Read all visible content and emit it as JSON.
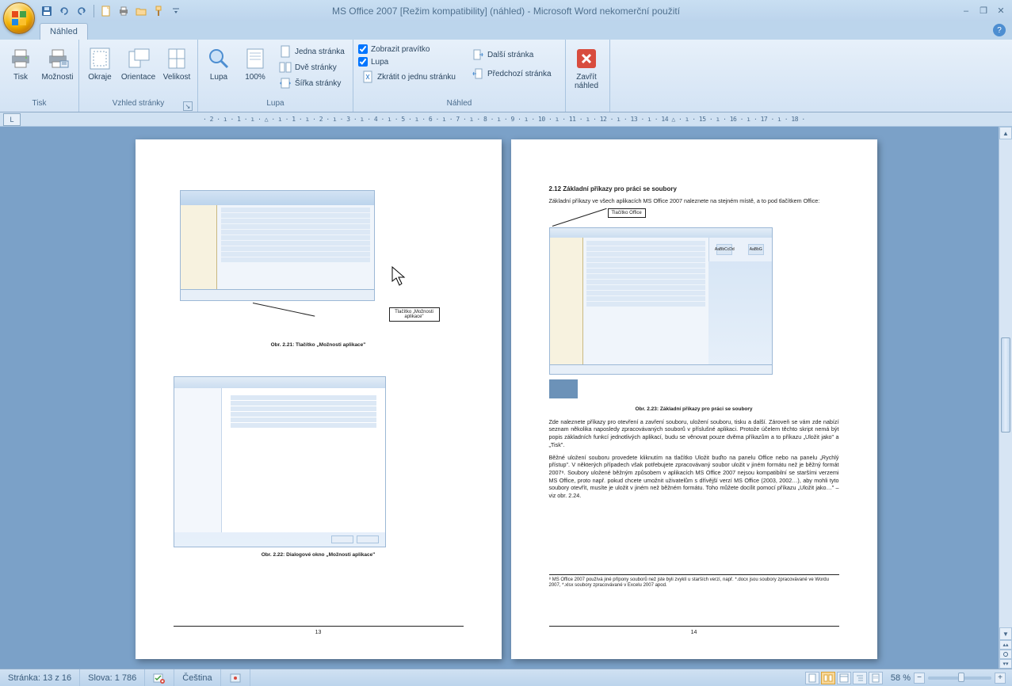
{
  "title": "MS Office 2007 [Režim kompatibility] (náhled) - Microsoft Word nekomerční použití",
  "tab": {
    "active": "Náhled"
  },
  "ribbon": {
    "print": {
      "label": "Tisk",
      "print_btn": "Tisk",
      "options_btn": "Možnosti"
    },
    "page_setup": {
      "label": "Vzhled stránky",
      "margins": "Okraje",
      "orientation": "Orientace",
      "size": "Velikost"
    },
    "zoom": {
      "label": "Lupa",
      "zoom_btn": "Lupa",
      "hundred": "100%",
      "one_page": "Jedna stránka",
      "two_pages": "Dvě stránky",
      "page_width": "Šířka stránky"
    },
    "preview": {
      "label": "Náhled",
      "show_ruler": "Zobrazit pravítko",
      "magnifier": "Lupa",
      "shrink": "Zkrátit o jednu stránku",
      "next_page": "Další stránka",
      "prev_page": "Předchozí stránka",
      "close": "Zavřít\nnáhled"
    }
  },
  "ruler_scale": "· 2 · ı · 1 · ı · △ · ı · 1 · ı · 2 · ı · 3 · ı · 4 · ı · 5 · ı · 6 · ı · 7 · ı · 8 · ı · 9 · ı · 10 · ı · 11 · ı · 12 · ı · 13 · ı · 14 △ · ı · 15 · ı · 16 · ı · 17 · ı · 18 ·",
  "doc": {
    "page_left": {
      "callout1": "Tlačítko „Možnosti aplikace\"",
      "fig1_caption": "Obr. 2.21: Tlačítko „Možnosti aplikace\"",
      "fig2_caption": "Obr. 2.22: Dialogové okno „Možnosti aplikace\"",
      "page_num": "13"
    },
    "page_right": {
      "section": "2.12  Základní příkazy pro práci se soubory",
      "para1": "Základní příkazy ve všech aplikacích MS Office 2007 naleznete na stejném místě, a to pod tlačítkem Office:",
      "callout2": "Tlačítko Office",
      "fig3_caption": "Obr. 2.23: Základní příkazy pro práci se soubory",
      "para2": "Zde naleznete příkazy pro otevření a zavření souboru, uložení souboru, tisku a další. Zároveň se vám zde nabízí seznam několika naposledy zpracovávaných souborů v příslušné aplikaci. Protože účelem těchto skript nemá být popis základních funkcí jednotlivých aplikací, budu se věnovat pouze dvěma příkazům a to příkazu „Uložit jako\" a „Tisk\".",
      "para3": "Běžné uložení souboru provedete kliknutím na tlačítko Uložit buďto na panelu Office nebo na panelu „Rychlý přístup\". V některých případech však potřebujete zpracovávaný soubor uložit v jiném formátu než je běžný formát 2007⁸. Soubory uložené běžným způsobem v aplikacích MS Office 2007 nejsou kompatibilní se staršími verzemi MS Office, proto např. pokud chcete umožnit uživatelům s dřívější verzí MS Office (2003, 2002…), aby mohli tyto soubory otevřít, musíte je uložit v jiném než běžném formátu. Toho můžete docílit pomocí příkazu „Uložit jako…\" – viz obr. 2.24.",
      "footnote": "⁸ MS Office 2007 používá jiné přípony souborů než jste byli zvyklí u starších verzí, např. *.docx jsou soubory zpracovávané ve Wordu 2007, *.xlsx soubory zpracovávané v Excelu 2007 apod.",
      "page_num": "14"
    }
  },
  "status": {
    "page": "Stránka: 13 z 16",
    "words": "Slova: 1 786",
    "language": "Čeština",
    "zoom_pct": "58 %"
  },
  "icons": {
    "save": "save-icon",
    "undo": "undo-icon",
    "redo": "redo-icon",
    "new": "new-icon",
    "print_q": "quickprint-icon",
    "open": "open-icon",
    "brush": "brush-icon"
  }
}
